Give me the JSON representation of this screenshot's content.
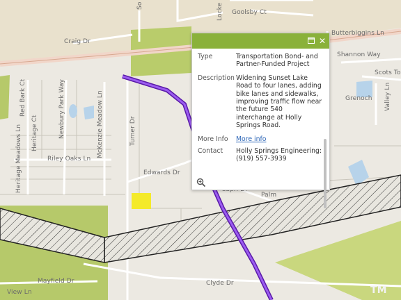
{
  "map": {
    "streets": {
      "goolsby": "Goolsby Ct",
      "craig": "Craig Dr",
      "locke": "Locke",
      "south": "So",
      "butterbiggins": "Butterbiggins Ln",
      "shannon": "Shannon Way",
      "scots": "Scots Tow",
      "grenoch": "Grenoch",
      "valley": "Valley Ln",
      "red_bark": "Red Bark Ct",
      "newbury_park": "Newbury Park Way",
      "mckenzie": "McKenzie Meadow Ln",
      "heritage_meadows": "Heritage Meadows Ln",
      "heritage_ct": "Heritage Ct",
      "riley_oaks": "Riley Oaks Ln",
      "turner": "Turner Dr",
      "edwards": "Edwards Dr",
      "capri": "Capri Dr",
      "palm": "Palm",
      "mayfield": "Mayfield Dr",
      "view": "View Ln",
      "clyde": "Clyde Dr"
    },
    "watermark": "TM"
  },
  "popup": {
    "fields": [
      {
        "key": "Type",
        "value": "Transportation Bond- and Partner-Funded Project"
      },
      {
        "key": "Description",
        "value": "Widening Sunset Lake Road to four lanes, adding bike lanes and sidewalks, improving traffic flow near the future 540 interchange at Holly Springs Road."
      },
      {
        "key": "More Info",
        "value": "More info"
      },
      {
        "key": "Contact",
        "value": "Holly Springs Engineering: (919) 557-3939"
      }
    ]
  },
  "colors": {
    "header": "#8ab13a",
    "route": "#8e3ee6",
    "park": "#b6c96a",
    "highlight": "#f4ea2a"
  }
}
